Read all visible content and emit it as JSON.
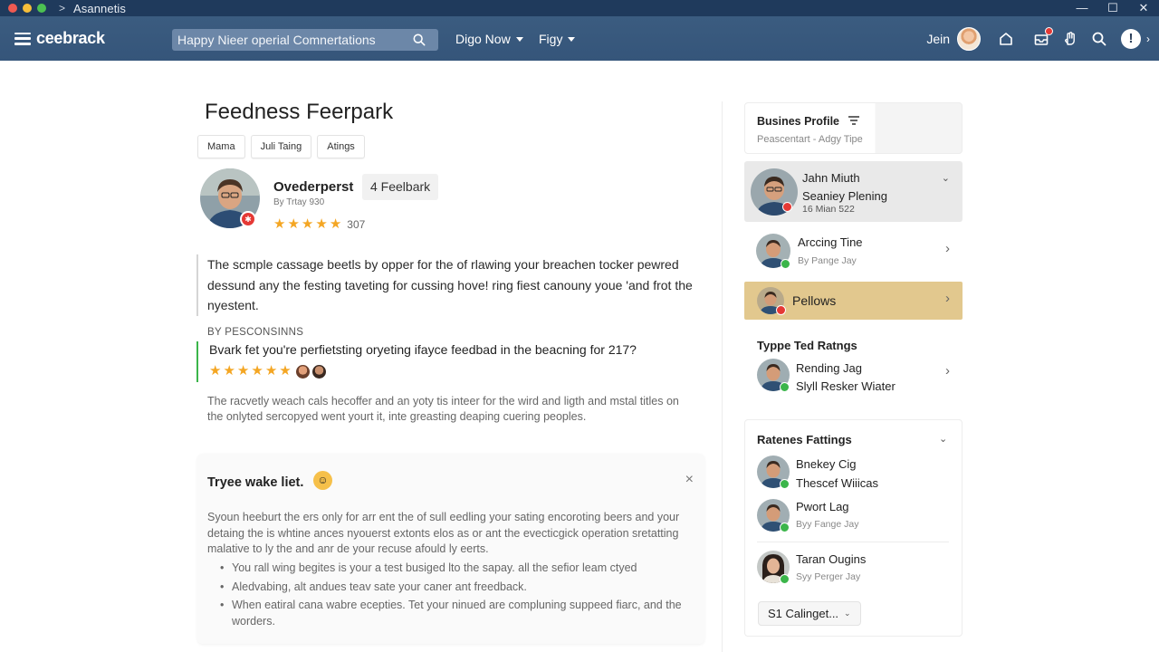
{
  "window": {
    "title": "Asannetis"
  },
  "nav": {
    "logo": "ceebrack",
    "search_placeholder": "Happy Nieer operial Comnertations",
    "menu1": "Digo Now",
    "menu2": "Figy",
    "user": "Jein"
  },
  "main": {
    "title": "Feedness Feerpark",
    "tabs": [
      "Mama",
      "Juli Taing",
      "Atings"
    ],
    "profile": {
      "name": "Ovederperst",
      "feedback_chip": "4 Feelbark",
      "subtitle": "By Trtay 930",
      "rating_count": "307",
      "stars": 5
    },
    "quote": "The scmple cassage beetls by opper for the of rlawing your breachen tocker pewred dessund any the festing taveting for cussing hove! ring fiest canouny youe 'and frot the nyestent.",
    "by_label": "BY PESCONSINNS",
    "question": "Bvark fet you're perfietsting oryeting ifayce feedbad in the beacning for 217?",
    "question_stars": 6,
    "body_paragraph": "The racvetly weach cals hecoffer and an yoty tis inteer for the wird and ligth and mstal titles on the onlyted sercopyed went yourt it, inte greasting deaping cuering peoples.",
    "card": {
      "title": "Tryee wake liet.",
      "close": "×",
      "paragraph": "Syoun heeburt the ers only for arr ent the of sull eedling your sating encoroting beers and your detaing the is whtine ances nyouerst extonts elos as or ant the evecticgick operation sretatting malative to ly the and anr de your recuse afould ly eerts.",
      "bullets": [
        "You rall wing begites is your a test busiged lto the sapay. all the sefior leam ctyed",
        "Aledvabing, alt andues teav sate your caner ant freedback.",
        "When eatiral cana wabre ecepties. Tet your ninued are compluning suppeed fiarc, and the worders."
      ]
    }
  },
  "sidebar": {
    "business_profile": {
      "title": "Busines Profile",
      "subtitle": "Peascentart - Adgy Tipe"
    },
    "featured": {
      "name": "Jahn Miuth",
      "role": "Seaniey Plening",
      "meta": "16 Mian 522"
    },
    "items": [
      {
        "name": "Arccing Tine",
        "sub": "By Pange Jay"
      },
      {
        "name": "Pellows"
      }
    ],
    "typed_ratings": {
      "title": "Typpe Ted Ratngs",
      "name": "Rending Jag",
      "sub": "Slyll Resker Wiater"
    },
    "ratings_section": {
      "title": "Ratenes Fattings",
      "items": [
        {
          "name": "Bnekey Cig",
          "sub": "Thescef Wiiicas"
        },
        {
          "name": "Pwort Lag",
          "sub": "Byy Fange Jay"
        },
        {
          "name": "Taran Ougins",
          "sub": "Syy Perger Jay"
        }
      ],
      "button": "S1 Calinget..."
    }
  },
  "colors": {
    "nav": "#3b5c80",
    "accent_green": "#3bb54a",
    "star": "#f4a623",
    "highlight": "#e2c88e"
  }
}
